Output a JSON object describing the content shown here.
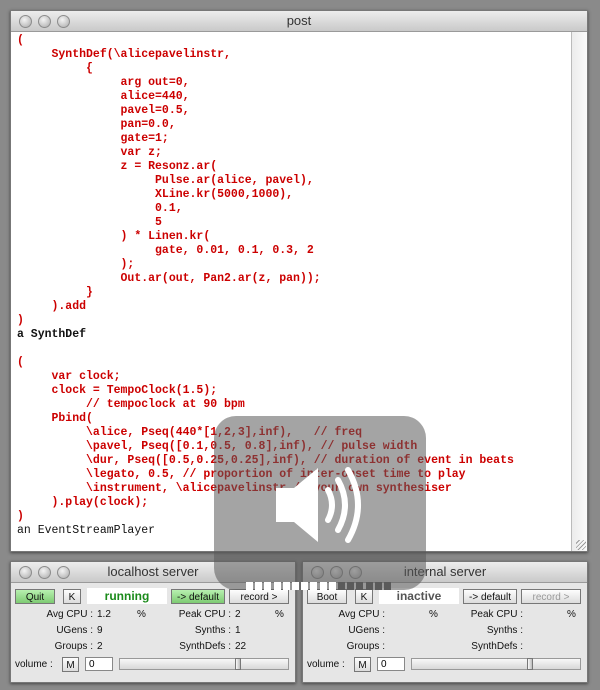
{
  "post_window": {
    "title": "post",
    "lines": [
      "(",
      "     SynthDef(\\alicepavelinstr,",
      "          {",
      "               arg out=0,",
      "               alice=440,",
      "               pavel=0.5,",
      "               pan=0.0,",
      "               gate=1;",
      "               var z;",
      "               z = Resonz.ar(",
      "                    Pulse.ar(alice, pavel),",
      "                    XLine.kr(5000,1000),",
      "                    0.1,",
      "                    5",
      "               ) * Linen.kr(",
      "                    gate, 0.01, 0.1, 0.3, 2",
      "               );",
      "               Out.ar(out, Pan2.ar(z, pan));",
      "          }",
      "     ).add",
      ")",
      "a SynthDef",
      "",
      "(",
      "     var clock;",
      "     clock = TempoClock(1.5);",
      "          // tempoclock at 90 bpm",
      "     Pbind(",
      "          \\alice, Pseq(440*[1,2,3],inf),   // freq",
      "          \\pavel, Pseq([0.1,0.5, 0.8],inf), // pulse width",
      "          \\dur, Pseq([0.5,0.25,0.25],inf), // duration of event in beats",
      "          \\legato, 0.5, // proportion of inter-onset time to play",
      "          \\instrument, \\alicepavelinstr // your own synthesiser",
      "     ).play(clock);",
      ")",
      "an EventStreamPlayer"
    ]
  },
  "localhost": {
    "title": "localhost server",
    "quit_label": "Quit",
    "k_label": "K",
    "status": "running",
    "default_label": "-> default",
    "record_label": "record >",
    "avg_cpu_label": "Avg CPU :",
    "avg_cpu_value": "1.2",
    "peak_cpu_label": "Peak CPU :",
    "peak_cpu_value": "2",
    "percent": "%",
    "ugens_label": "UGens :",
    "ugens_value": "9",
    "synths_label": "Synths :",
    "synths_value": "1",
    "groups_label": "Groups :",
    "groups_value": "2",
    "synthdefs_label": "SynthDefs :",
    "synthdefs_value": "22",
    "volume_label": "volume :",
    "m_label": "M",
    "volume_value": "0"
  },
  "internal": {
    "title": "internal server",
    "boot_label": "Boot",
    "k_label": "K",
    "status": "inactive",
    "default_label": "-> default",
    "record_label": "record >",
    "avg_cpu_label": "Avg CPU :",
    "peak_cpu_label": "Peak CPU :",
    "percent": "%",
    "ugens_label": "UGens :",
    "synths_label": "Synths :",
    "groups_label": "Groups :",
    "synthdefs_label": "SynthDefs :",
    "volume_label": "volume :",
    "m_label": "M",
    "volume_value": "0"
  },
  "volume_hud": {
    "icon": "speaker-icon",
    "level": 0.6
  },
  "colors": {
    "code": "#cc0000",
    "output": "#111111",
    "running": "#1a8a1a",
    "inactive": "#555555"
  }
}
